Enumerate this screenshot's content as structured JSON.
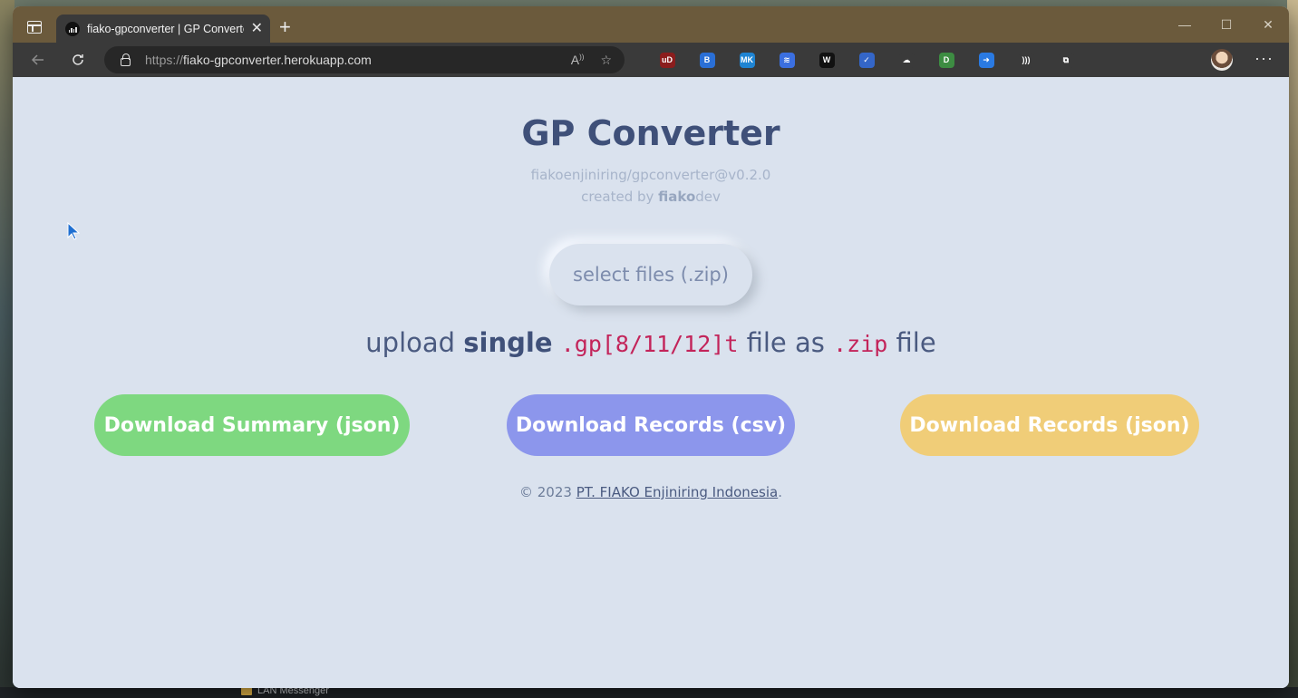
{
  "browser": {
    "tab": {
      "title": "fiako-gpconverter | GP Converter",
      "close": "✕"
    },
    "new_tab": "+",
    "window_controls": {
      "minimize": "—",
      "maximize": "☐",
      "close": "✕"
    },
    "address": {
      "scheme": "https://",
      "host": "fiako-gpconverter.herokuapp.com"
    },
    "extensions": [
      {
        "name": "ublock-icon",
        "label": "uD",
        "color": "#8b1d1d"
      },
      {
        "name": "bitwarden-icon",
        "label": "B",
        "color": "#2a6fd6"
      },
      {
        "name": "mk-icon",
        "label": "MK",
        "color": "#1f84d2"
      },
      {
        "name": "feather-icon",
        "label": "≋",
        "color": "#3b6fe0"
      },
      {
        "name": "w-icon",
        "label": "W",
        "color": "#111111"
      },
      {
        "name": "check-icon",
        "label": "✓",
        "color": "#3466c8"
      },
      {
        "name": "cloud-icon",
        "label": "☁",
        "color": "#3a3a3a"
      },
      {
        "name": "pushbullet-icon",
        "label": "D",
        "color": "#3d8c42"
      },
      {
        "name": "share-icon",
        "label": "➜",
        "color": "#2a7ae2"
      },
      {
        "name": "wifi-icon",
        "label": ")))",
        "color": "#3a3a3a"
      },
      {
        "name": "puzzle-icon",
        "label": "⧉",
        "color": "#3a3a3a"
      }
    ],
    "more": "···"
  },
  "page": {
    "title": "GP Converter",
    "version": "fiakoenjiniring/gpconverter@v0.2.0",
    "creator_prefix": "created by ",
    "creator_bold": "fiako",
    "creator_suffix": "dev",
    "select_files": "select files (.zip)",
    "instruction": {
      "prefix": "upload ",
      "bold": "single",
      "code1": ".gp[8/11/12]t",
      "middle": " file as ",
      "code2": ".zip",
      "suffix": " file"
    },
    "buttons": {
      "summary_json": "Download Summary (json)",
      "records_csv": "Download Records (csv)",
      "records_json": "Download Records (json)"
    },
    "footer": {
      "prefix": "© 2023 ",
      "link": "PT. FIAKO Enjiniring Indonesia",
      "suffix": "."
    }
  },
  "taskbar": {
    "item": "LAN Messenger"
  }
}
